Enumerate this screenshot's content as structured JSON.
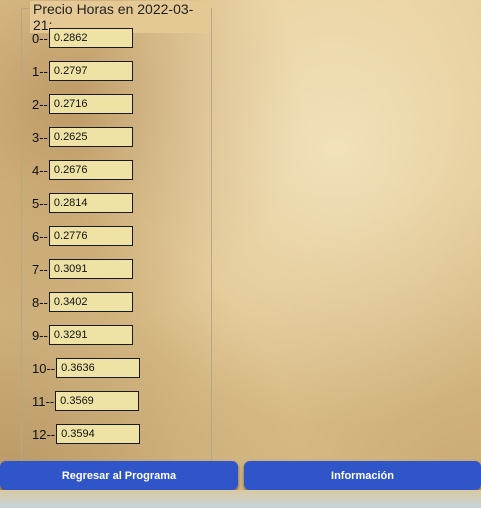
{
  "panel": {
    "legend": "Precio Horas en 2022-03-21:"
  },
  "hours": [
    {
      "label": "0--",
      "value": "0.2862"
    },
    {
      "label": "1--",
      "value": "0.2797"
    },
    {
      "label": "2--",
      "value": "0.2716"
    },
    {
      "label": "3--",
      "value": "0.2625"
    },
    {
      "label": "4--",
      "value": "0.2676"
    },
    {
      "label": "5--",
      "value": "0.2814"
    },
    {
      "label": "6--",
      "value": "0.2776"
    },
    {
      "label": "7--",
      "value": "0.3091"
    },
    {
      "label": "8--",
      "value": "0.3402"
    },
    {
      "label": "9--",
      "value": "0.3291"
    },
    {
      "label": "10--",
      "value": "0.3636"
    },
    {
      "label": "11--",
      "value": "0.3569"
    },
    {
      "label": "12--",
      "value": "0.3594"
    }
  ],
  "buttons": {
    "back": "Regresar al Programa",
    "info": "Información"
  }
}
